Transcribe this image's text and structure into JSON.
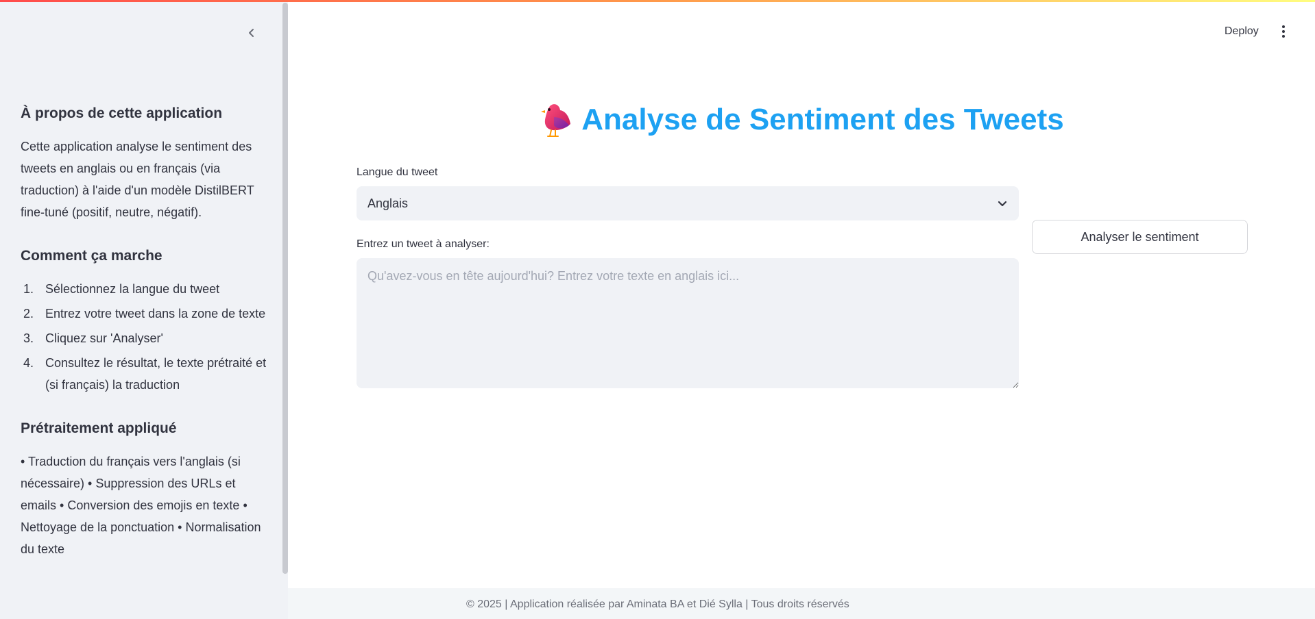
{
  "sidebar": {
    "about": {
      "heading": "À propos de cette application",
      "text": "Cette application analyse le sentiment des tweets en anglais ou en français (via traduction) à l'aide d'un modèle DistilBERT fine-tuné (positif, neutre, négatif)."
    },
    "how": {
      "heading": "Comment ça marche",
      "steps": [
        {
          "num": "1.",
          "text": "Sélectionnez la langue du tweet"
        },
        {
          "num": "2.",
          "text": "Entrez votre tweet dans la zone de texte"
        },
        {
          "num": "3.",
          "text": "Cliquez sur 'Analyser'"
        },
        {
          "num": "4.",
          "text": "Consultez le résultat, le texte prétraité et (si français) la traduction"
        }
      ]
    },
    "preprocessing": {
      "heading": "Prétraitement appliqué",
      "text": "• Traduction du français vers l'anglais (si nécessaire) • Suppression des URLs et emails • Conversion des emojis en texte • Nettoyage de la ponctuation • Normalisation du texte"
    }
  },
  "header": {
    "deploy_label": "Deploy"
  },
  "main": {
    "title": "Analyse de Sentiment des Tweets",
    "language_label": "Langue du tweet",
    "language_value": "Anglais",
    "tweet_label": "Entrez un tweet à analyser:",
    "tweet_placeholder": "Qu'avez-vous en tête aujourd'hui? Entrez votre texte en anglais ici...",
    "analyze_button": "Analyser le sentiment"
  },
  "footer": {
    "text": "© 2025 | Application réalisée par Aminata BA et Dié Sylla | Tous droits réservés"
  },
  "colors": {
    "title": "#1da1f2",
    "sidebar_bg": "#f0f2f6",
    "input_bg": "#f0f2f6"
  },
  "icons": {
    "collapse": "chevron-left-icon",
    "menu": "more-vertical-icon",
    "title": "bird-icon",
    "select": "chevron-down-icon"
  }
}
